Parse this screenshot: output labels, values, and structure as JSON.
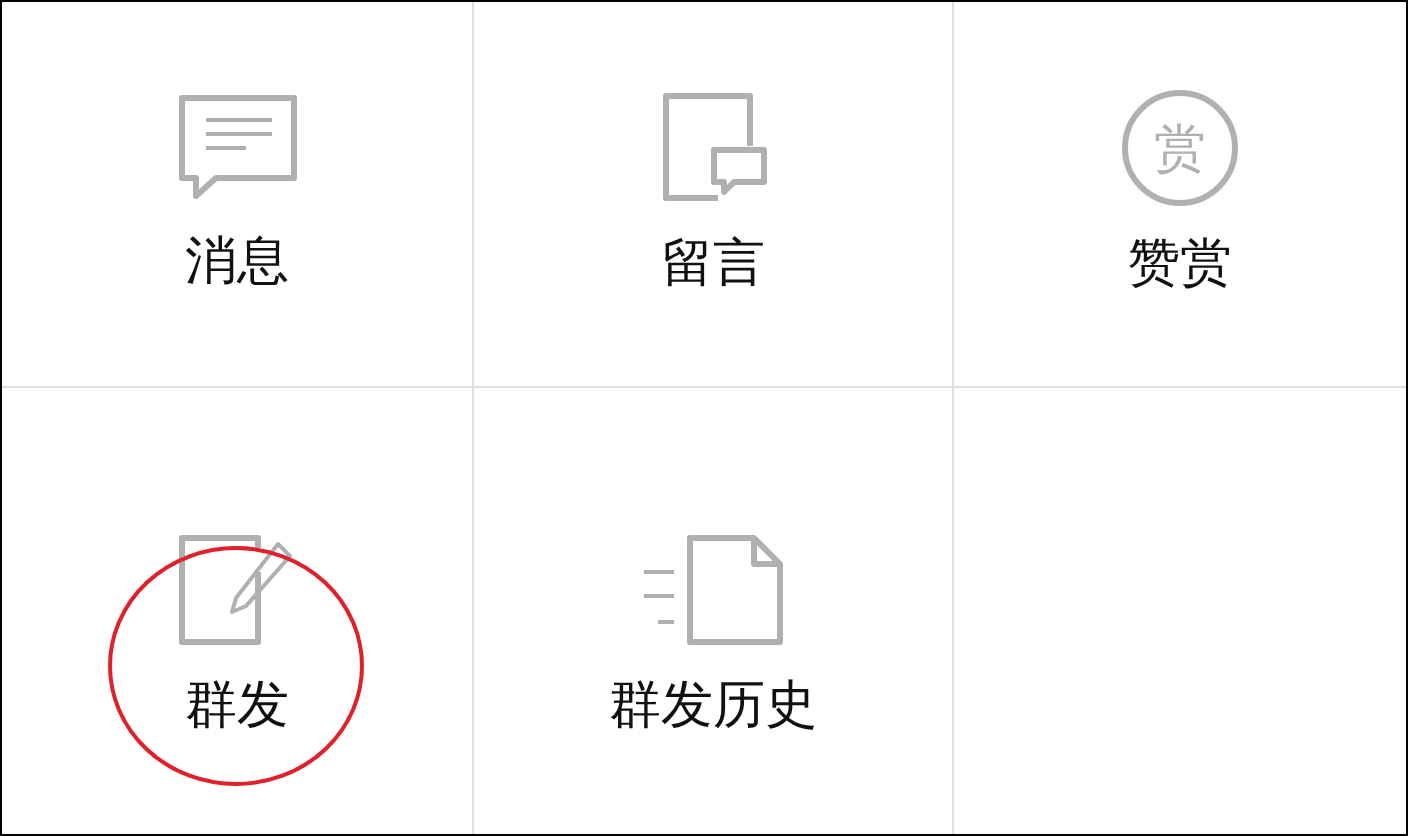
{
  "items": [
    {
      "kind": "message",
      "label": "消息",
      "circled": false
    },
    {
      "kind": "comment",
      "label": "留言",
      "circled": false
    },
    {
      "kind": "reward",
      "label": "赞赏",
      "icon_text": "赏",
      "circled": false
    },
    {
      "kind": "broadcast",
      "label": "群发",
      "circled": true
    },
    {
      "kind": "history",
      "label": "群发历史",
      "circled": false
    }
  ]
}
